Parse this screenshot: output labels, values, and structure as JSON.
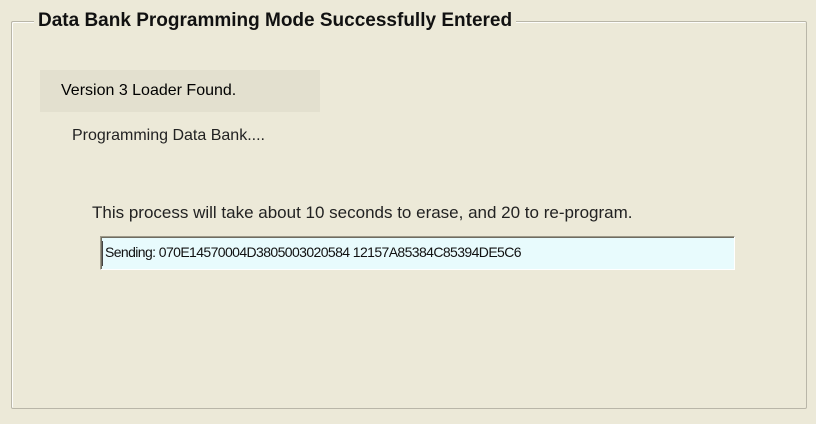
{
  "groupbox": {
    "title": "Data Bank Programming Mode Successfully Entered"
  },
  "status": {
    "loader_found": "Version 3 Loader Found.",
    "programming": "Programming Data Bank....",
    "process_note": "This process will take about 10 seconds to erase, and 20 to re-program."
  },
  "sending_field": {
    "value": "Sending: 070E14570004D3805003020584 12157A85384C85394DE5C6"
  },
  "colors": {
    "background": "#ece9d8",
    "field_background": "#e8fbfd",
    "group_border": "#b9b6a8"
  }
}
